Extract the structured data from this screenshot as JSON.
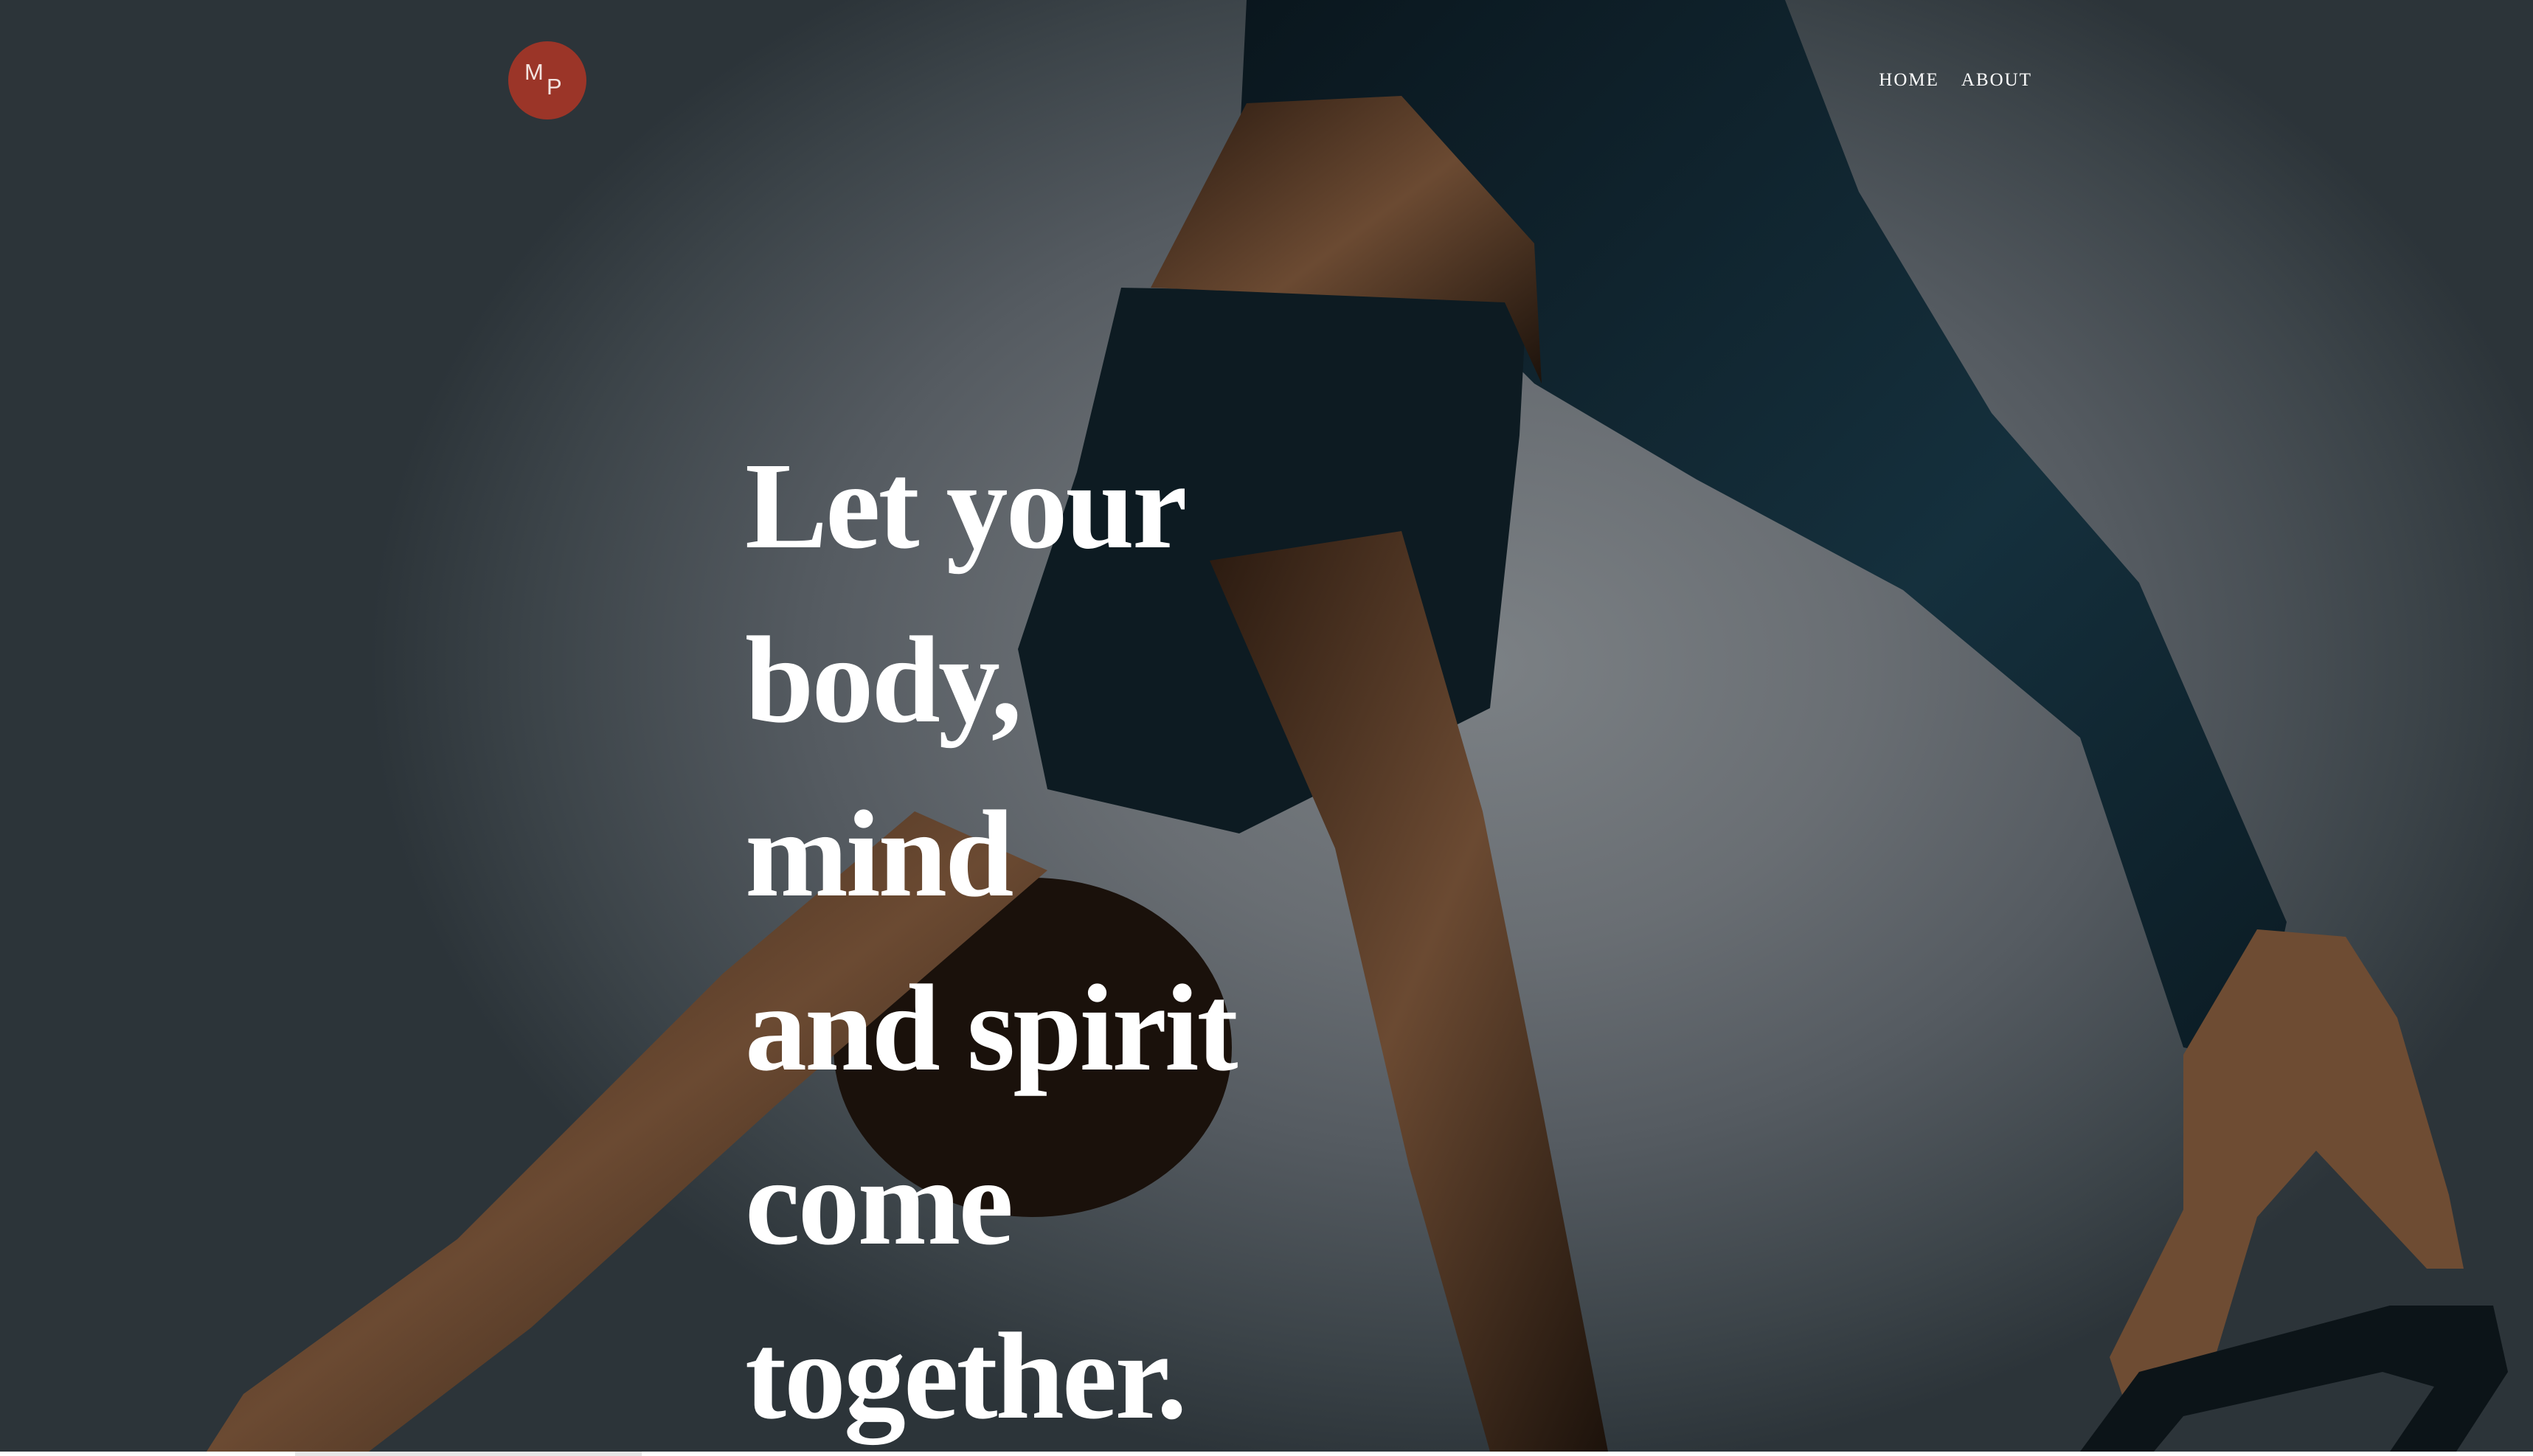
{
  "header": {
    "logo": {
      "letter_top": "M",
      "letter_bottom": "P",
      "color": "#9b3528"
    },
    "nav": [
      {
        "label": "HOME"
      },
      {
        "label": "ABOUT"
      }
    ]
  },
  "hero": {
    "headline_lines": [
      "Let your",
      "body,",
      "mind",
      "and spirit",
      "come",
      "together."
    ],
    "text_color": "#ffffff",
    "background_color": "#5e6469"
  }
}
